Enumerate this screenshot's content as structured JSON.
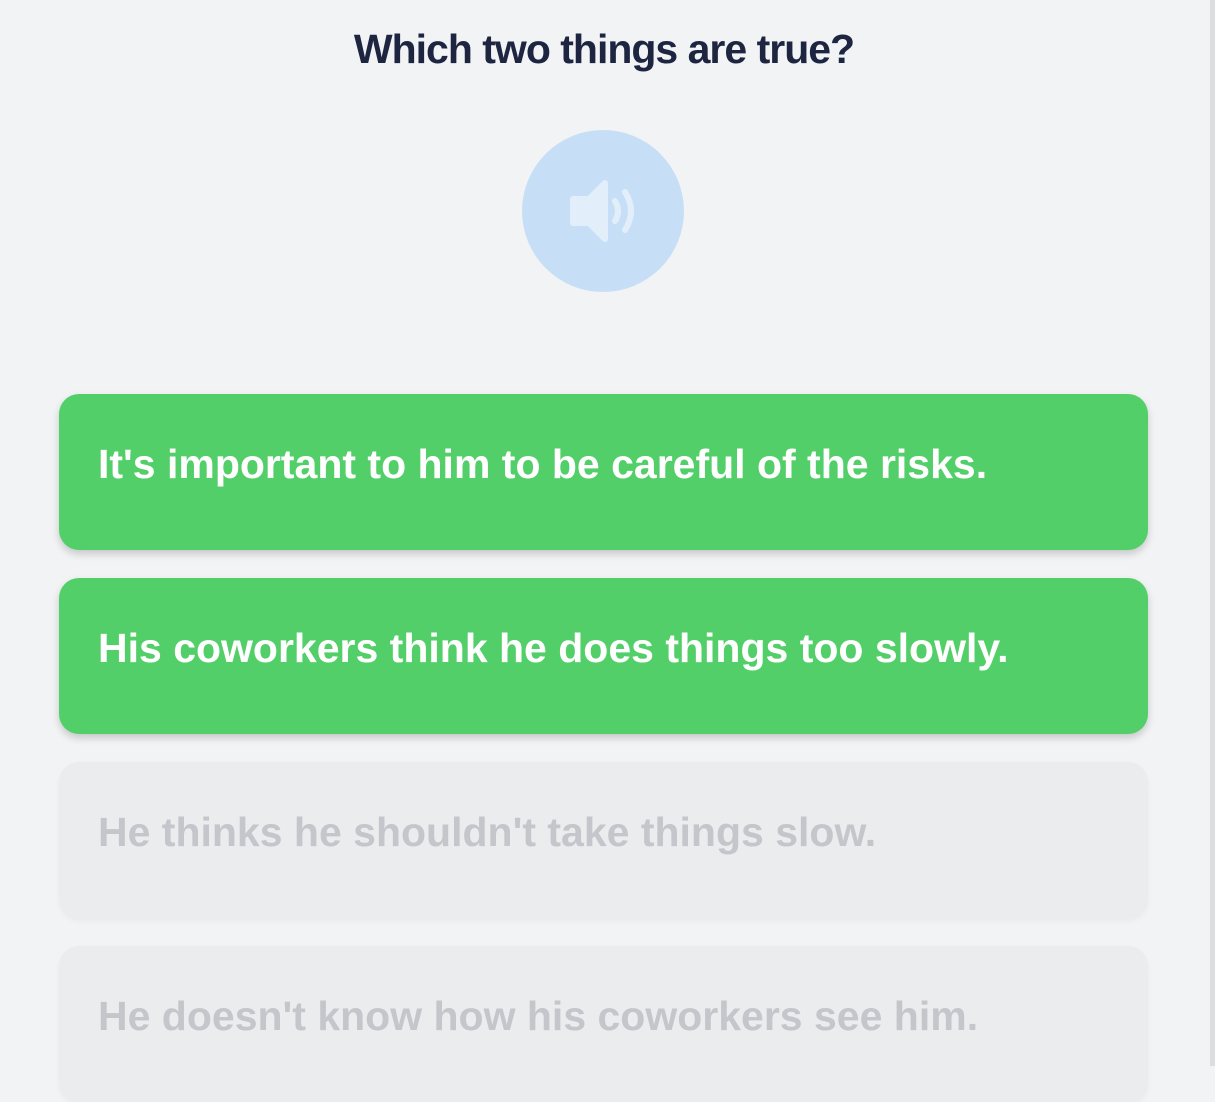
{
  "question": {
    "title": "Which two things are true?"
  },
  "audio": {
    "icon": "speaker-icon"
  },
  "options": [
    {
      "label": "It's important to him to be careful of the risks.",
      "state": "selected"
    },
    {
      "label": "His coworkers think he does things too slowly.",
      "state": "selected"
    },
    {
      "label": "He thinks he shouldn't take things slow.",
      "state": "disabled"
    },
    {
      "label": "He doesn't know how his coworkers see him.",
      "state": "disabled"
    }
  ],
  "colors": {
    "background": "#f2f3f5",
    "title": "#1e2540",
    "selected": "#53cf69",
    "disabled": "#ebecee",
    "disabled_text": "#c4c6cb",
    "audio_button": "#c7dff6"
  }
}
